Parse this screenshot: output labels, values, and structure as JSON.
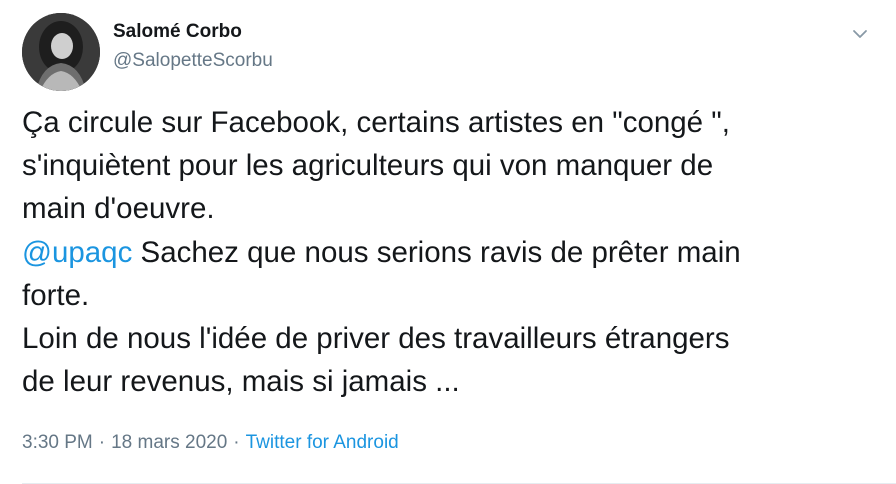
{
  "author": {
    "display_name": "Salomé Corbo",
    "handle": "@SalopetteScorbu"
  },
  "caret_icon": "chevron-down-icon",
  "tweet": {
    "line1": "Ça  circule sur Facebook, certains artistes en \"congé \",",
    "line2": "s'inquiètent pour les agriculteurs qui von manquer de",
    "line3": "main d'oeuvre.",
    "mention": "@upaqc",
    "line4_rest": " Sachez que nous serions ravis de prêter main",
    "line5": "forte.",
    "line6": "Loin de nous l'idée de priver des travailleurs étrangers",
    "line7": "de leur revenus, mais si jamais ..."
  },
  "meta": {
    "time": "3:30 PM",
    "separator": "·",
    "date": "18 mars 2020",
    "source": "Twitter for Android"
  },
  "colors": {
    "text": "#14171a",
    "secondary": "#657786",
    "link": "#1b95e0"
  }
}
